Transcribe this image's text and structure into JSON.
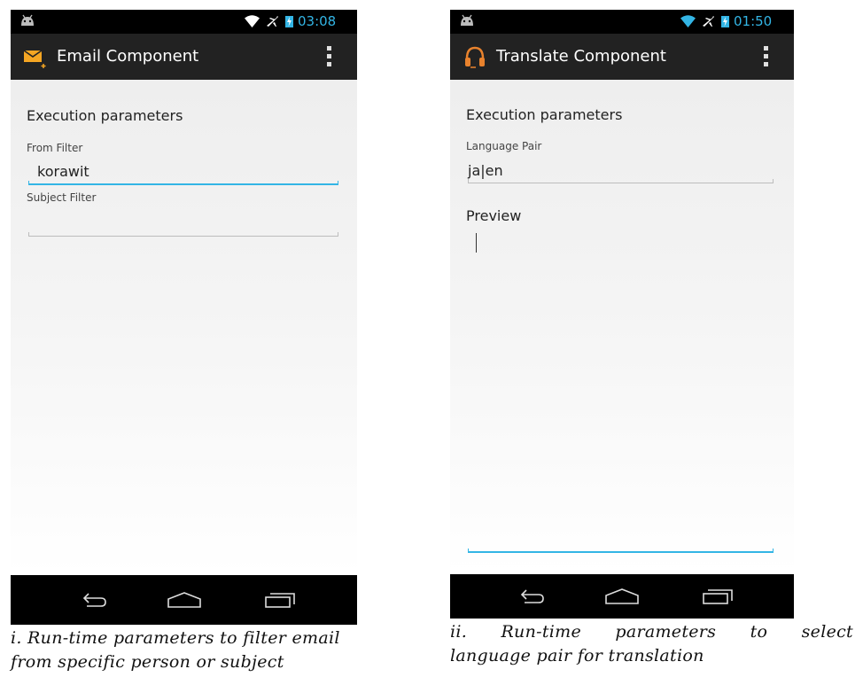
{
  "colors": {
    "accent": "#33b5e5",
    "action_bar": "#222222",
    "email_icon": "#f5a623",
    "translate_icon": "#e8822d"
  },
  "screen1": {
    "status_time": "03:08",
    "app_icon": "email-add-icon",
    "title": "Email Component",
    "section_header": "Execution parameters",
    "from_filter_label": "From Filter",
    "from_filter_value": "korawit",
    "subject_filter_label": "Subject Filter",
    "subject_filter_value": "",
    "caption_line1": "i. Run-time parameters to filter email",
    "caption_line2": "from specific person or subject"
  },
  "screen2": {
    "status_time": "01:50",
    "app_icon": "headphones-icon",
    "title": "Translate Component",
    "section_header": "Execution parameters",
    "language_pair_label": "Language Pair",
    "language_pair_value": "ja|en",
    "preview_label": "Preview",
    "preview_value": "",
    "caption_line1": "ii. Run-time parameters to select",
    "caption_line2": "language pair for translation"
  }
}
